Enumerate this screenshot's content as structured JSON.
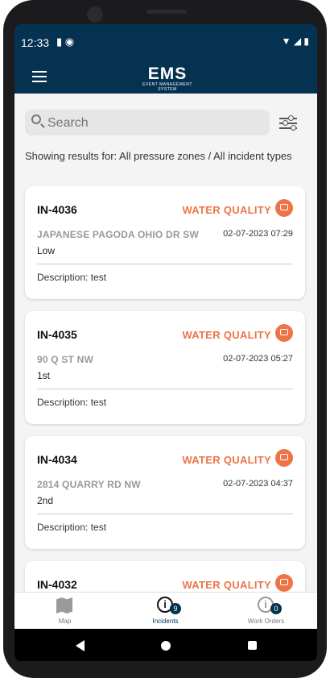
{
  "status_bar": {
    "time": "12:33",
    "icons": [
      "sd-card-icon",
      "sync-icon"
    ],
    "right_icons": [
      "wifi-icon",
      "signal-icon",
      "battery-icon"
    ]
  },
  "app_bar": {
    "logo_main": "EMS",
    "logo_sub": "EVENT MANAGEMENT SYSTEM"
  },
  "search": {
    "placeholder": "Search"
  },
  "results_text": "Showing results for: All pressure zones / All incident types",
  "colors": {
    "header": "#053251",
    "accent": "#ee7447",
    "background": "#f4f4f4"
  },
  "incidents": [
    {
      "id": "IN-4036",
      "type": "WATER QUALITY",
      "address": "JAPANESE PAGODA OHIO DR SW",
      "datetime": "02-07-2023 07:29",
      "zone": "Low",
      "description": "Description: test"
    },
    {
      "id": "IN-4035",
      "type": "WATER QUALITY",
      "address": "90 Q ST NW",
      "datetime": "02-07-2023 05:27",
      "zone": "1st",
      "description": "Description: test"
    },
    {
      "id": "IN-4034",
      "type": "WATER QUALITY",
      "address": "2814 QUARRY RD NW",
      "datetime": "02-07-2023 04:37",
      "zone": "2nd",
      "description": "Description: test"
    },
    {
      "id": "IN-4032",
      "type": "WATER QUALITY",
      "address": "",
      "datetime": "",
      "zone": "",
      "description": ""
    }
  ],
  "bottom_nav": {
    "map": "Map",
    "incidents": "Incidents",
    "incidents_badge": "9",
    "work_orders": "Work Orders",
    "work_orders_badge": "0",
    "active": "incidents"
  }
}
